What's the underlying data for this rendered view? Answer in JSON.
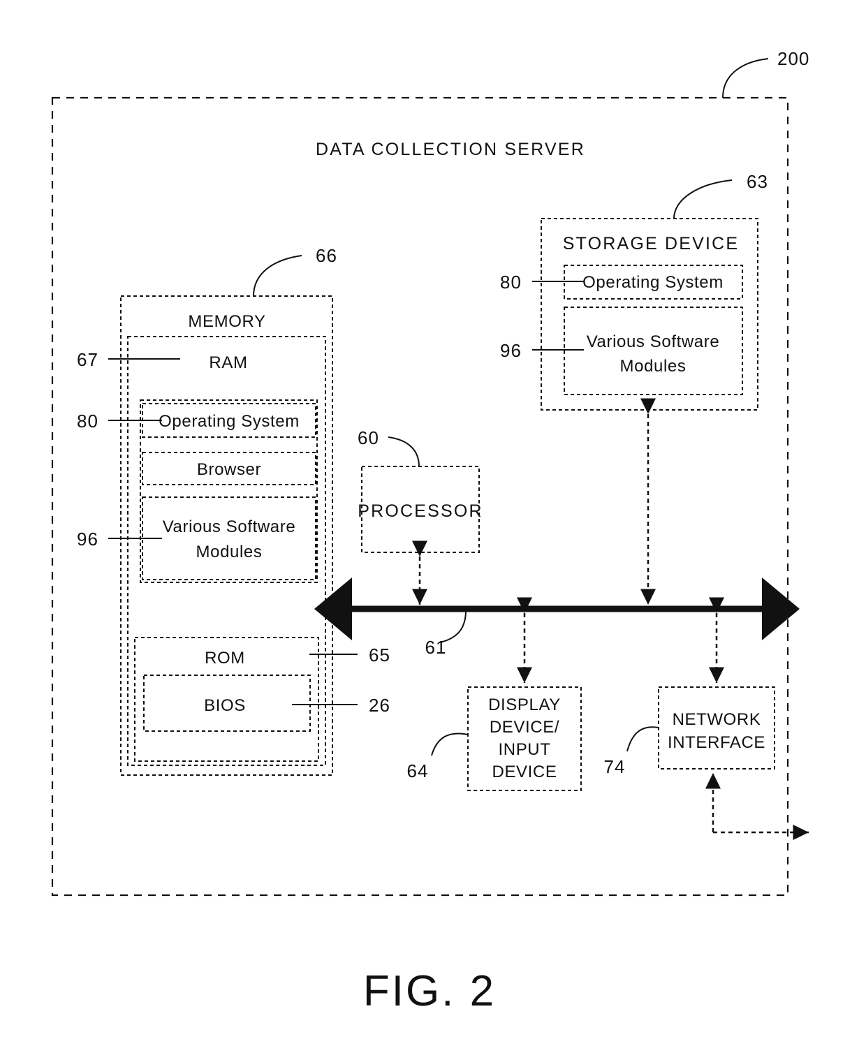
{
  "figure": {
    "caption": "FIG. 2",
    "system_ref": "200",
    "title": "DATA COLLECTION SERVER"
  },
  "blocks": {
    "memory": {
      "label": "MEMORY",
      "ref": "66",
      "ram": {
        "label": "RAM",
        "ref": "67"
      },
      "operating_system": {
        "label": "Operating System",
        "ref": "80"
      },
      "browser": {
        "label": "Browser"
      },
      "software_modules": {
        "label": "Various Software\nModules",
        "line1": "Various Software",
        "line2": "Modules",
        "ref": "96"
      },
      "rom": {
        "label": "ROM",
        "ref": "65"
      },
      "bios": {
        "label": "BIOS",
        "ref": "26"
      }
    },
    "storage_device": {
      "label": "STORAGE DEVICE",
      "ref": "63",
      "operating_system": {
        "label": "Operating System",
        "ref": "80"
      },
      "software_modules": {
        "line1": "Various Software",
        "line2": "Modules",
        "ref": "96"
      }
    },
    "processor": {
      "label": "PROCESSOR",
      "ref": "60"
    },
    "bus": {
      "ref": "61"
    },
    "display_input_device": {
      "line1": "DISPLAY",
      "line2": "DEVICE/",
      "line3": "INPUT",
      "line4": "DEVICE",
      "ref": "64"
    },
    "network_interface": {
      "line1": "NETWORK",
      "line2": "INTERFACE",
      "ref": "74"
    }
  },
  "colors": {
    "ink": "#111111",
    "background": "#ffffff"
  }
}
